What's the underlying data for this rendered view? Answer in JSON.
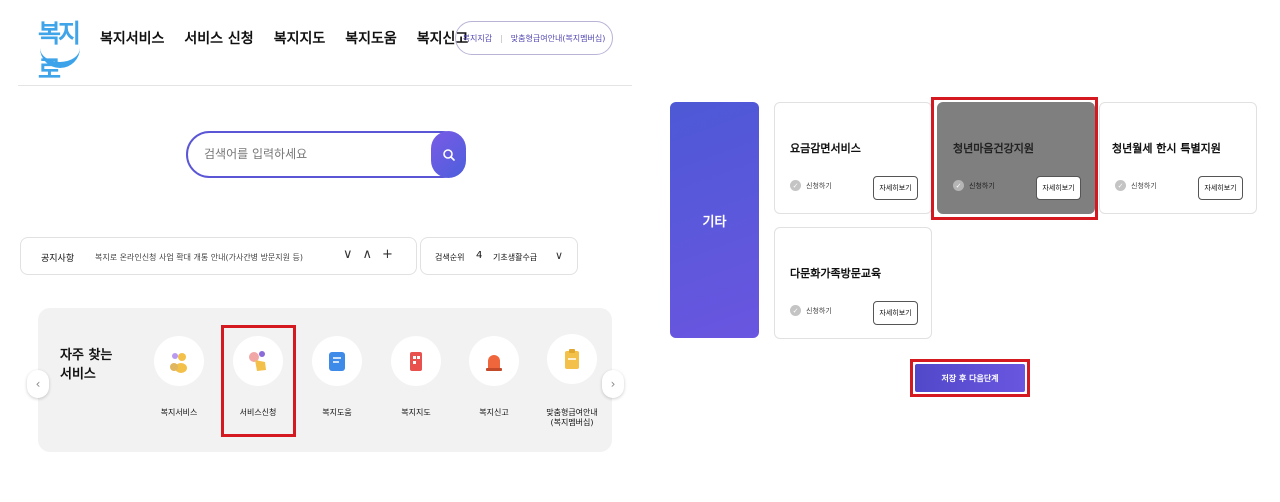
{
  "logo": {
    "text": "복지로"
  },
  "gnb": [
    "복지서비스",
    "서비스 신청",
    "복지지도",
    "복지도움",
    "복지신고"
  ],
  "util": {
    "link1": "복지지갑",
    "separator": "|",
    "link2": "맞춤형급여안내(복지멤버십)"
  },
  "search": {
    "placeholder": "검색어를 입력하세요",
    "button_icon": "search-icon"
  },
  "notice": {
    "label": "공지사항",
    "text": "복지로 온라인신청 사업 확대 개통 안내(가사간병 방문지원 등)",
    "controls": [
      "∨",
      "∧",
      "+"
    ]
  },
  "rank": {
    "label": "검색순위",
    "number": "4",
    "text": "기초생활수급",
    "chevron": "∨"
  },
  "favorites": {
    "title": "자주 찾는 서비스",
    "prev": "‹",
    "next": "›",
    "items": [
      {
        "label": "복지서비스",
        "icon": "people-icon"
      },
      {
        "label": "서비스신청",
        "icon": "hand-click-icon"
      },
      {
        "label": "복지도움",
        "icon": "document-icon"
      },
      {
        "label": "복지지도",
        "icon": "building-icon"
      },
      {
        "label": "복지신고",
        "icon": "siren-icon"
      },
      {
        "label": "맞춤형급여안내\n(복지멤버십)",
        "icon": "clipboard-icon"
      }
    ]
  },
  "category": {
    "label": "기타"
  },
  "cards": [
    {
      "title": "요금감면서비스",
      "apply": "신청하기",
      "detail": "자세히보기"
    },
    {
      "title": "청년마음건강지원",
      "apply": "신청하기",
      "detail": "자세히보기"
    },
    {
      "title": "청년월세 한시 특별지원",
      "apply": "신청하기",
      "detail": "자세히보기"
    },
    {
      "title": "다문화가족방문교육",
      "apply": "신청하기",
      "detail": "자세히보기"
    }
  ],
  "save_button": {
    "label": "저장 후 다음단계"
  },
  "colors": {
    "accent": "#5a56d6",
    "highlight": "#d41920",
    "selected_card": "#7f7f7f",
    "logo": "#3fa4e8"
  }
}
